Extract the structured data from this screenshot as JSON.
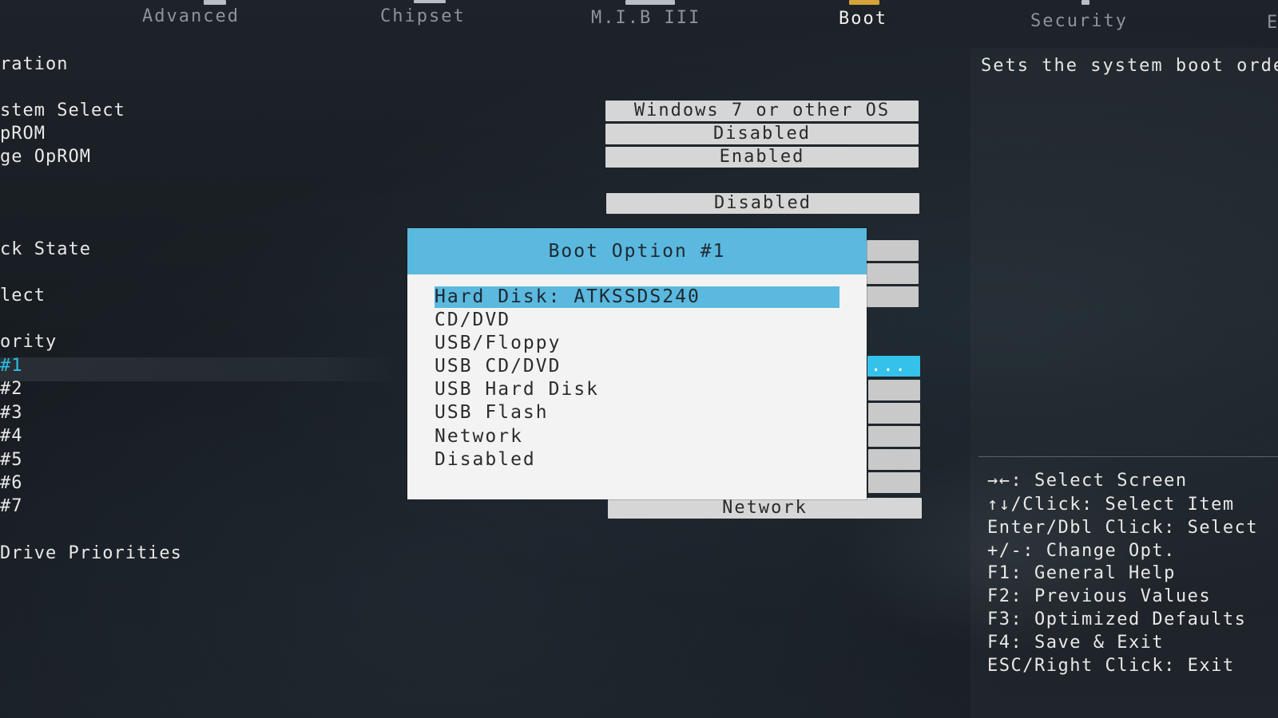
{
  "tabs": [
    {
      "label": "Advanced"
    },
    {
      "label": "Chipset"
    },
    {
      "label": "M.I.B III"
    },
    {
      "label": "Boot"
    },
    {
      "label": "Security"
    },
    {
      "label": "E"
    }
  ],
  "menu": {
    "items": [
      {
        "label": "ration"
      },
      {
        "label": "stem Select"
      },
      {
        "label": "pROM"
      },
      {
        "label": "ge OpROM"
      },
      {
        "label": "ck State"
      },
      {
        "label": "lect"
      },
      {
        "label": "ority"
      },
      {
        "label": "#1"
      },
      {
        "label": "#2"
      },
      {
        "label": "#3"
      },
      {
        "label": "#4"
      },
      {
        "label": "#5"
      },
      {
        "label": "#6"
      },
      {
        "label": "#7"
      },
      {
        "label": "Drive Priorities"
      }
    ]
  },
  "values": {
    "os_select": "Windows 7 or other OS",
    "v2": "Disabled",
    "v3": "Enabled",
    "v4": "Disabled",
    "active_dots": "...",
    "last": "Network"
  },
  "popup": {
    "title": "Boot Option #1",
    "options": [
      {
        "label": "Hard Disk: ATKSSDS240"
      },
      {
        "label": "CD/DVD"
      },
      {
        "label": "USB/Floppy"
      },
      {
        "label": "USB CD/DVD"
      },
      {
        "label": "USB Hard Disk"
      },
      {
        "label": "USB Flash"
      },
      {
        "label": "Network"
      },
      {
        "label": "Disabled"
      }
    ],
    "selected": "Hard Disk: ATKSSDS240"
  },
  "help": {
    "description": "Sets the system boot orde",
    "keys": [
      "→←: Select Screen",
      "↑↓/Click: Select Item",
      "Enter/Dbl Click: Select",
      "+/-: Change Opt.",
      "F1: General Help",
      "F2: Previous Values",
      "F3: Optimized Defaults",
      "F4: Save & Exit",
      "ESC/Right Click: Exit"
    ]
  },
  "colors": {
    "accent": "#35c2ea",
    "popup_header": "#5bb8de",
    "boot_tab_icon": "#d6a23a"
  }
}
